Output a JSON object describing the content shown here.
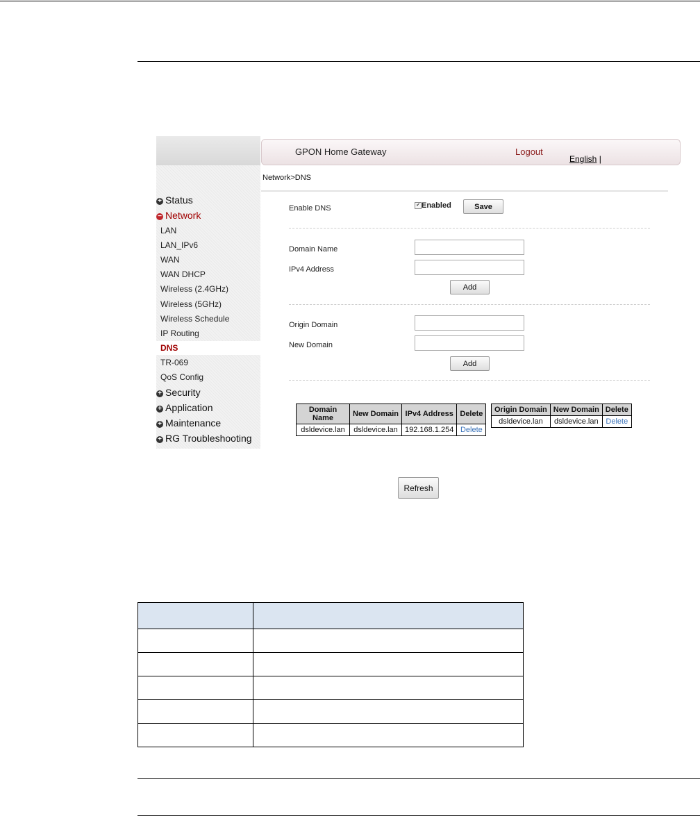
{
  "header": {
    "app_title": "GPON Home Gateway",
    "logout": "Logout",
    "language": "English",
    "lang_sep": "|"
  },
  "breadcrumb": "Network>DNS",
  "sidebar": {
    "items": [
      {
        "label": "Status",
        "type": "top",
        "toggle": "+"
      },
      {
        "label": "Network",
        "type": "top",
        "toggle": "−",
        "open": true
      },
      {
        "label": "LAN"
      },
      {
        "label": "LAN_IPv6"
      },
      {
        "label": "WAN"
      },
      {
        "label": "WAN DHCP"
      },
      {
        "label": "Wireless (2.4GHz)"
      },
      {
        "label": "Wireless (5GHz)"
      },
      {
        "label": "Wireless Schedule"
      },
      {
        "label": "IP Routing"
      },
      {
        "label": "DNS",
        "active": true
      },
      {
        "label": "TR-069"
      },
      {
        "label": "QoS Config"
      },
      {
        "label": "Security",
        "type": "top",
        "toggle": "+"
      },
      {
        "label": "Application",
        "type": "top",
        "toggle": "+"
      },
      {
        "label": "Maintenance",
        "type": "top",
        "toggle": "+"
      },
      {
        "label": "RG Troubleshooting",
        "type": "top",
        "toggle": "+"
      }
    ]
  },
  "enable_dns": {
    "label": "Enable DNS",
    "checkbox_label": "Enabled",
    "checked": true,
    "save": "Save"
  },
  "host_form": {
    "domain_label": "Domain Name",
    "domain_value": "",
    "ipv4_label": "IPv4 Address",
    "ipv4_value": "",
    "add": "Add"
  },
  "alias_form": {
    "origin_label": "Origin Domain",
    "origin_value": "",
    "new_label": "New Domain",
    "new_value": "",
    "add": "Add"
  },
  "host_table": {
    "headers": [
      "Domain Name",
      "New Domain",
      "IPv4 Address",
      "Delete"
    ],
    "rows": [
      [
        "dsldevice.lan",
        "dsldevice.lan",
        "192.168.1.254",
        "Delete"
      ]
    ]
  },
  "alias_table": {
    "headers": [
      "Origin Domain",
      "New Domain",
      "Delete"
    ],
    "rows": [
      [
        "dsldevice.lan",
        "dsldevice.lan",
        "Delete"
      ]
    ]
  },
  "refresh": "Refresh",
  "icons": {
    "checkbox": "checkmark-icon",
    "expand": "plus-circle-icon",
    "collapse": "minus-circle-icon"
  },
  "colors": {
    "active_red": "#a00000",
    "link_blue": "#3b73b9",
    "doc_header_blue": "#dbe5f1"
  },
  "doc_table": {
    "rows": 6,
    "columns": 2
  }
}
